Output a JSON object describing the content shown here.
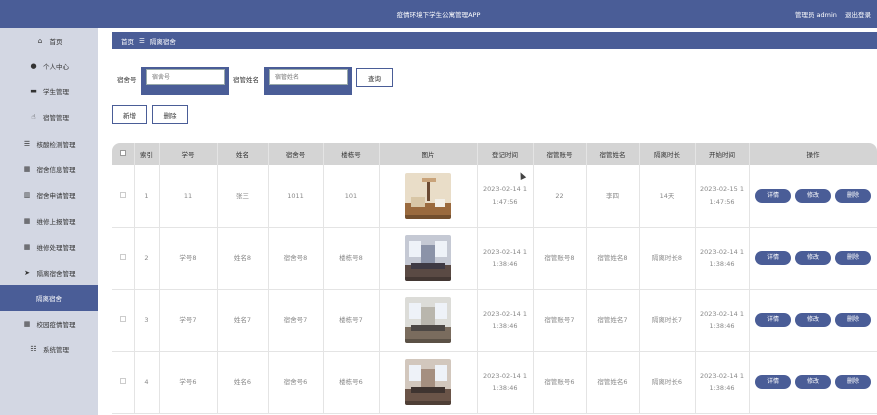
{
  "app": {
    "title": "疫情环境下学生公寓管理APP"
  },
  "user": {
    "label": "管理员 admin",
    "logout": "退出登录"
  },
  "sidebar": {
    "items": [
      {
        "label": "首页",
        "icon": "home-icon",
        "glyph": "⌂"
      },
      {
        "label": "个人中心",
        "icon": "user-icon",
        "glyph": "●"
      },
      {
        "label": "学生管理",
        "icon": "monitor-icon",
        "glyph": "▬"
      },
      {
        "label": "宿管管理",
        "icon": "thumbs-up-icon",
        "glyph": "☝"
      },
      {
        "label": "核酸检测管理",
        "icon": "list-icon",
        "glyph": "☰"
      },
      {
        "label": "宿舍信息管理",
        "icon": "grid-icon",
        "glyph": "▦"
      },
      {
        "label": "宿舍申请管理",
        "icon": "bar-chart-icon",
        "glyph": "▥"
      },
      {
        "label": "维修上报管理",
        "icon": "grid-icon",
        "glyph": "▦"
      },
      {
        "label": "维修处理管理",
        "icon": "grid-icon",
        "glyph": "▦"
      },
      {
        "label": "隔离宿舍管理",
        "icon": "send-icon",
        "glyph": "➤"
      },
      {
        "label": "隔离宿舍",
        "icon": "",
        "glyph": ""
      },
      {
        "label": "校园疫情管理",
        "icon": "grid-icon",
        "glyph": "▦"
      },
      {
        "label": "系统管理",
        "icon": "sliders-icon",
        "glyph": "☷"
      }
    ],
    "active_index": 10
  },
  "breadcrumb": {
    "home": "首页",
    "sep": "☰",
    "current": "隔离宿舍"
  },
  "search": {
    "dorm_label": "宿舍号",
    "dorm_placeholder": "宿舍号",
    "manager_label": "宿管姓名",
    "manager_placeholder": "宿管姓名",
    "query_button": "查询"
  },
  "toolbar": {
    "add": "新增",
    "delete": "删除"
  },
  "table": {
    "columns": [
      "",
      "索引",
      "学号",
      "姓名",
      "宿舍号",
      "楼栋号",
      "图片",
      "登记时间",
      "宿管账号",
      "宿管姓名",
      "隔离时长",
      "开始时间",
      "操作"
    ],
    "actions": {
      "detail": "详情",
      "edit": "修改",
      "delete": "删除"
    },
    "rows": [
      {
        "index": "1",
        "student_id": "11",
        "name": "张三",
        "dorm": "1011",
        "building": "101",
        "photo": "room-photo-1",
        "reg_time_1": "2023-02-14 1",
        "reg_time_2": "1:47:56",
        "manager_account": "22",
        "manager_name": "李四",
        "duration": "14天",
        "start_1": "2023-02-15 1",
        "start_2": "1:47:56"
      },
      {
        "index": "2",
        "student_id": "学号8",
        "name": "姓名8",
        "dorm": "宿舍号8",
        "building": "楼栋号8",
        "photo": "room-photo-2",
        "reg_time_1": "2023-02-14 1",
        "reg_time_2": "1:38:46",
        "manager_account": "宿管账号8",
        "manager_name": "宿管姓名8",
        "duration": "隔离时长8",
        "start_1": "2023-02-14 1",
        "start_2": "1:38:46"
      },
      {
        "index": "3",
        "student_id": "学号7",
        "name": "姓名7",
        "dorm": "宿舍号7",
        "building": "楼栋号7",
        "photo": "room-photo-3",
        "reg_time_1": "2023-02-14 1",
        "reg_time_2": "1:38:46",
        "manager_account": "宿管账号7",
        "manager_name": "宿管姓名7",
        "duration": "隔离时长7",
        "start_1": "2023-02-14 1",
        "start_2": "1:38:46"
      },
      {
        "index": "4",
        "student_id": "学号6",
        "name": "姓名6",
        "dorm": "宿舍号6",
        "building": "楼栋号6",
        "photo": "room-photo-4",
        "reg_time_1": "2023-02-14 1",
        "reg_time_2": "1:38:46",
        "manager_account": "宿管账号6",
        "manager_name": "宿管姓名6",
        "duration": "隔离时长6",
        "start_1": "2023-02-14 1",
        "start_2": "1:38:46"
      }
    ]
  },
  "colors": {
    "primary": "#4a5d97",
    "sidebar_bg": "#d3d7e3",
    "table_header": "#d4d4d4"
  }
}
